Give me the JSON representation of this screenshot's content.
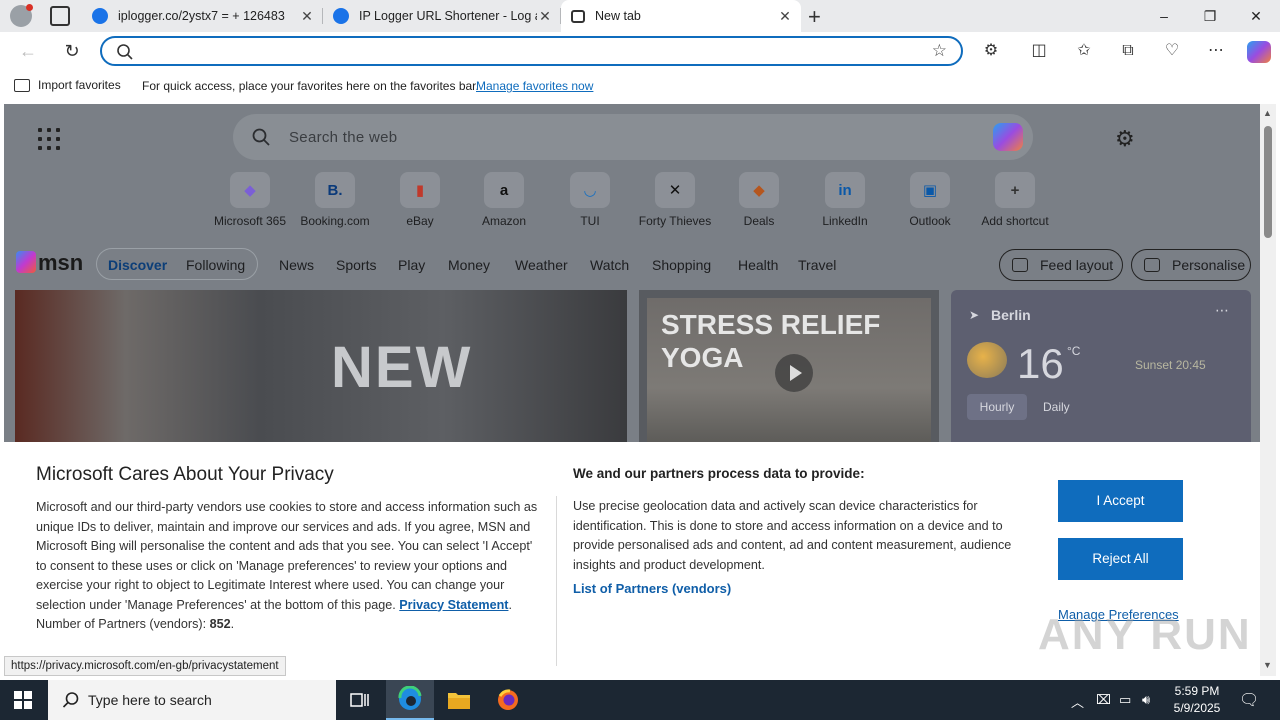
{
  "browser": {
    "tabs": [
      {
        "title": "iplogger.co/2ystx7 = + 126483",
        "active": false
      },
      {
        "title": "IP Logger URL Shortener - Log an",
        "active": false
      },
      {
        "title": "New tab",
        "active": true
      }
    ],
    "window_controls": {
      "minimize": "–",
      "restore": "❐",
      "close": "✕"
    },
    "address_bar": {
      "value": "",
      "placeholder": ""
    },
    "favorites_bar": {
      "import_label": "Import favorites",
      "tip": "For quick access, place your favorites here on the favorites bar.",
      "manage_link": "Manage favorites now"
    }
  },
  "newtab": {
    "search_placeholder": "Search the web",
    "shortcuts": [
      {
        "label": "Microsoft 365",
        "glyph": "◆",
        "color": "#7b5fd6"
      },
      {
        "label": "Booking.com",
        "glyph": "B.",
        "color": "#0b3a7a"
      },
      {
        "label": "eBay",
        "glyph": "▮",
        "color": "#c0392b"
      },
      {
        "label": "Amazon",
        "glyph": "a",
        "color": "#111111"
      },
      {
        "label": "TUI",
        "glyph": "◡",
        "color": "#1a70c0"
      },
      {
        "label": "Forty Thieves",
        "glyph": "✕",
        "color": "#111111"
      },
      {
        "label": "Deals",
        "glyph": "◆",
        "color": "#b5561e"
      },
      {
        "label": "LinkedIn",
        "glyph": "in",
        "color": "#0a58a8"
      },
      {
        "label": "Outlook",
        "glyph": "▣",
        "color": "#0a58a8"
      },
      {
        "label": "Add shortcut",
        "glyph": "+",
        "color": "#333333"
      }
    ],
    "msn": {
      "logo": "msn",
      "toggle": [
        "Discover",
        "Following"
      ],
      "nav": [
        "News",
        "Sports",
        "Play",
        "Money",
        "Weather",
        "Watch",
        "Shopping",
        "Health",
        "Travel"
      ],
      "feed_layout": "Feed layout",
      "personalise": "Personalise"
    },
    "cards": {
      "main_sign": "NEW",
      "video_headline": "STRESS RELIEF YOGA",
      "weather": {
        "city": "Berlin",
        "temp": "16",
        "unit": "°C",
        "sunset": "Sunset 20:45",
        "tabs": [
          "Hourly",
          "Daily"
        ]
      }
    }
  },
  "privacy": {
    "title": "Microsoft Cares About Your Privacy",
    "body": "Microsoft and our third-party vendors use cookies to store and access information such as unique IDs to deliver, maintain and improve our services and ads. If you agree, MSN and Microsoft Bing will personalise the content and ads that you see. You can select 'I Accept' to consent to these uses or click on 'Manage preferences' to review your options and exercise your right to object to Legitimate Interest where used.  You can change your selection under 'Manage Preferences' at the bottom of this page.",
    "privacy_link": "Privacy Statement",
    "partners_label": "Number of Partners (vendors):",
    "partners_count": "852",
    "subtitle": "We and our partners process data to provide:",
    "desc": "Use precise geolocation data and actively scan device characteristics for identification. This is done to store and access information on a device and to provide personalised ads and content, ad and content measurement, audience insights and product development.",
    "partners_link": "List of Partners (vendors)",
    "accept": "I Accept",
    "reject": "Reject All",
    "manage": "Manage Preferences"
  },
  "status_url": "https://privacy.microsoft.com/en-gb/privacystatement",
  "watermark": "ANY RUN",
  "taskbar": {
    "search_placeholder": "Type here to search",
    "time": "5:59 PM",
    "date": "5/9/2025"
  }
}
